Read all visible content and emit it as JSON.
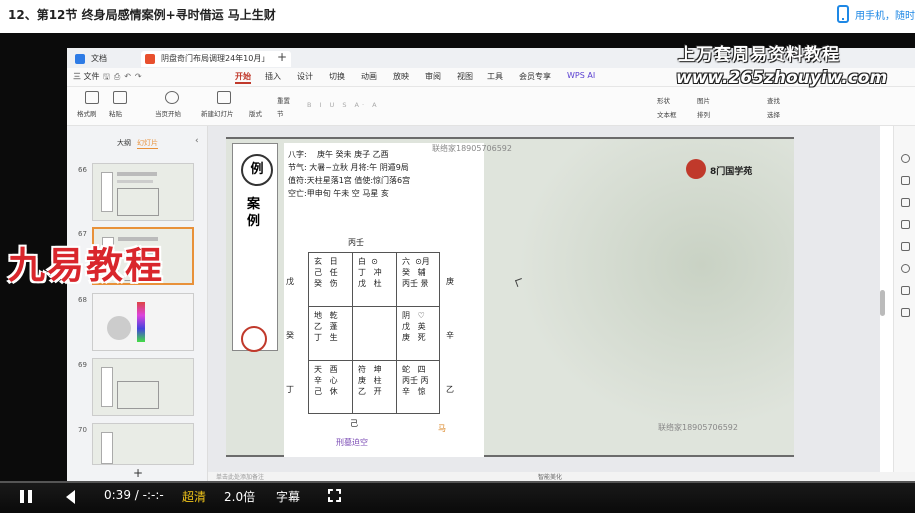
{
  "header": {
    "title": "12、第12节 终身局感情案例+寻时借运 马上生财",
    "phone_text": "用手机，随时"
  },
  "window": {
    "tabs": [
      {
        "label": "文档",
        "icon": "home-icon"
      },
      {
        "label": "阴盘奇门布局调理24年10月」",
        "icon": "ppt-file-icon"
      }
    ],
    "menu": [
      "三 文件",
      "开始",
      "插入",
      "设计",
      "切换",
      "动画",
      "放映",
      "审阅",
      "视图",
      "工具",
      "会员专享",
      "WPS AI"
    ],
    "active_menu": "开始",
    "ribbon": [
      "格式刷",
      "粘贴",
      "当页开始",
      "新建幻灯片",
      "版式",
      "节",
      "重置",
      "形状",
      "图片",
      "文本框",
      "排列",
      "查找",
      "选择"
    ]
  },
  "sidebar": {
    "tab_outline": "大纲",
    "tab_slides": "幻灯片",
    "slides": [
      {
        "num": "66"
      },
      {
        "num": "67"
      },
      {
        "num": "68"
      },
      {
        "num": "69"
      },
      {
        "num": "70"
      }
    ],
    "add": "+"
  },
  "slide": {
    "case_mark": "例",
    "case_label": "案例",
    "bazi_label": "八字:",
    "bazi": "庚午  癸未  庚子  乙酉",
    "jieqi": "节气: 大暑~立秋 月将:午 阴遁9局",
    "zhifu": "值符:天柱星落1宫 值使:惊门落6宫",
    "kongwang": "空亡:甲申旬 午未 空 马星 亥",
    "contact_top": "联络家18905706592",
    "contact_bottom": "联络家18905706592",
    "brand": "8门国学苑",
    "top_stem": "丙壬",
    "bottom_stem": "己",
    "bottom_note": "刑墓迫空",
    "horse_mark": "马",
    "left_stems": [
      "戊",
      "癸",
      "丁"
    ],
    "right_stems": [
      "庚",
      "辛",
      "乙"
    ],
    "palaces": [
      {
        "lines": [
          "玄   日",
          "己   任",
          "癸   伤"
        ]
      },
      {
        "lines": [
          "白  ⊙",
          "丁   冲",
          "戊   杜"
        ]
      },
      {
        "lines": [
          "六  ⊙月",
          "癸   辅",
          "丙壬 景"
        ]
      },
      {
        "lines": [
          "地   乾",
          "乙   蓬",
          "丁   生"
        ]
      },
      {
        "lines": [
          ""
        ]
      },
      {
        "lines": [
          "阴   ♡",
          "戊   英",
          "庚   死"
        ]
      },
      {
        "lines": [
          "天   酉",
          "辛   心",
          "己   休"
        ]
      },
      {
        "lines": [
          "符   坤",
          "庚   柱",
          "乙   开"
        ]
      },
      {
        "lines": [
          "蛇   四",
          "丙壬 丙",
          "辛   惊"
        ]
      }
    ]
  },
  "watermarks": {
    "top": "上万套周易资料教程",
    "url": "www.265zhouyiw.com",
    "left": "九易教程"
  },
  "status": {
    "left": "单击此处添加备注",
    "right_text": "智能美化"
  },
  "player": {
    "time": "0:39 / -:-:-",
    "quality": "超清",
    "speed": "2.0倍",
    "subtitle": "字幕"
  }
}
